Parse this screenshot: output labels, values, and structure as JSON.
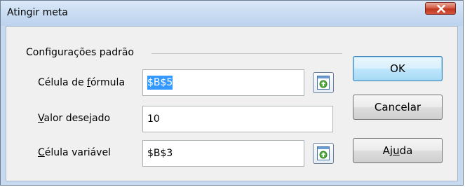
{
  "window": {
    "title": "Atingir meta",
    "close_label": "X"
  },
  "group": {
    "label": "Configurações padrão"
  },
  "formula_cell": {
    "label_pre": "Célula de ",
    "label_mnemonic": "f",
    "label_post": "órmula",
    "value": "$B$5"
  },
  "target_value": {
    "label_mnemonic": "V",
    "label_post": "alor desejado",
    "value": "10"
  },
  "variable_cell": {
    "label_mnemonic": "C",
    "label_post": "élula variável",
    "value": "$B$3"
  },
  "buttons": {
    "ok": "OK",
    "cancel": "Cancelar",
    "help_pre": "Aj",
    "help_mnemonic": "u",
    "help_post": "da"
  },
  "icons": {
    "close": "close-icon",
    "shrink": "shrink-dialog-icon"
  },
  "colors": {
    "selection": "#3399ff",
    "close_button": "#c1381f",
    "default_button_border": "#3c7fb1"
  }
}
